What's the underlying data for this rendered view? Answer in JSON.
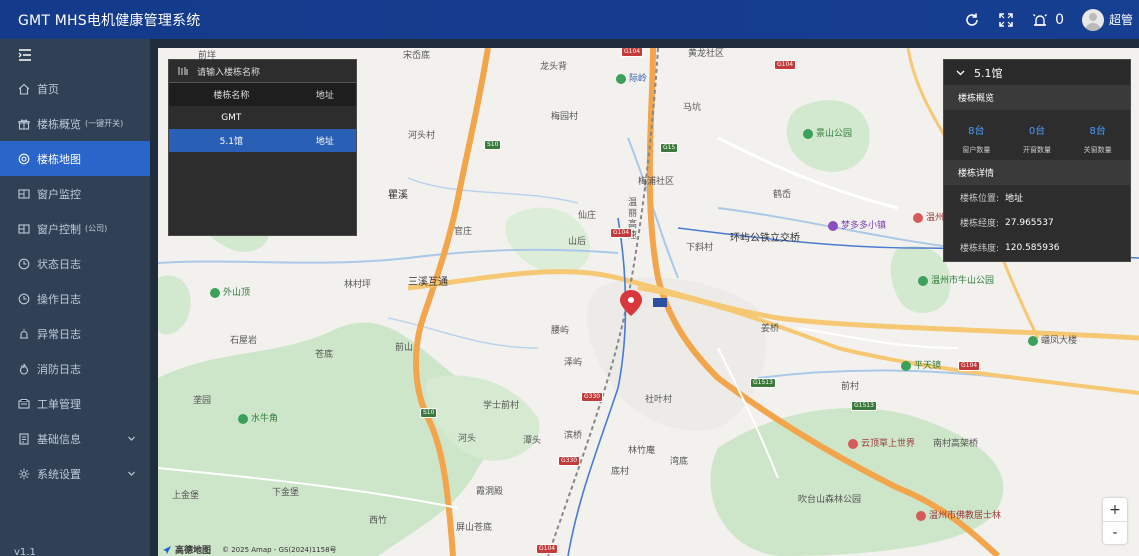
{
  "header": {
    "title": "GMT MHS电机健康管理系统",
    "alarm_count": "0",
    "username": "超管"
  },
  "sidebar": {
    "items": [
      {
        "label": "首页",
        "sub": "",
        "icon": "home-icon"
      },
      {
        "label": "楼栋概览",
        "sub": "(一键开关)",
        "icon": "gift-icon"
      },
      {
        "label": "楼栋地图",
        "sub": "",
        "icon": "target-icon"
      },
      {
        "label": "窗户监控",
        "sub": "",
        "icon": "window-icon"
      },
      {
        "label": "窗户控制",
        "sub": "(公司)",
        "icon": "window-icon"
      },
      {
        "label": "状态日志",
        "sub": "",
        "icon": "clock-icon"
      },
      {
        "label": "操作日志",
        "sub": "",
        "icon": "clock-icon"
      },
      {
        "label": "异常日志",
        "sub": "",
        "icon": "alarm-icon"
      },
      {
        "label": "消防日志",
        "sub": "",
        "icon": "fire-icon"
      },
      {
        "label": "工单管理",
        "sub": "",
        "icon": "ticket-icon"
      },
      {
        "label": "基础信息",
        "sub": "",
        "icon": "document-icon"
      },
      {
        "label": "系统设置",
        "sub": "",
        "icon": "gear-icon"
      }
    ],
    "active_index": 2,
    "version": "v1.1"
  },
  "building_list": {
    "search_placeholder": "请输入楼栋名称",
    "columns": [
      "楼栋名称",
      "地址"
    ],
    "rows": [
      {
        "name": "GMT",
        "address": ""
      },
      {
        "name": "5.1馆",
        "address": "地址"
      }
    ],
    "selected_index": 1
  },
  "building_detail": {
    "title": "5.1馆",
    "overview_label": "楼栋概览",
    "stats": [
      {
        "value": "8台",
        "label": "窗户数量"
      },
      {
        "value": "0台",
        "label": "开窗数量"
      },
      {
        "value": "8台",
        "label": "关窗数量"
      }
    ],
    "details_label": "楼栋详情",
    "position_label": "楼栋位置:",
    "position_value": "地址",
    "lng_label": "楼栋经度:",
    "lng_value": "27.965537",
    "lat_label": "楼栋纬度:",
    "lat_value": "120.585936"
  },
  "map": {
    "labels": [
      "前垟",
      "宋岙底",
      "黄龙社区",
      "龙头背",
      "际岭",
      "马坑",
      "梅园村",
      "景山公园",
      "河头村",
      "梅浦社区",
      "鹤岙",
      "温州",
      "瞿溪",
      "温丽高速",
      "仙庄",
      "山后",
      "环屿公铁立交桥",
      "梦多多小镇",
      "官庄",
      "下斜村",
      "三溪互通",
      "林村坪",
      "外山顶",
      "腰屿",
      "泽屿",
      "温州市牛山公园",
      "石屋岩",
      "苍底",
      "前山",
      "姜桥",
      "平天镜",
      "蟠凤大楼",
      "滨桥",
      "学士前村",
      "社叶村",
      "前村",
      "垄园",
      "水牛角",
      "南村高架桥",
      "云顶草上世界",
      "河头",
      "潭头",
      "林竹庵",
      "湾底",
      "底村",
      "上金堡",
      "下金堡",
      "霞洞殿",
      "西竹",
      "屏山苍底",
      "吹台山森林公园",
      "温州市佛教居士林"
    ],
    "roads": [
      "G104",
      "G15",
      "S10",
      "G1513",
      "G330"
    ],
    "zoom_in": "+",
    "zoom_out": "-",
    "logo": "高德地图",
    "copyright": "© 2025 Amap - GS(2024)1158号"
  },
  "colors": {
    "header_bg": "#153a8a",
    "sidebar_bg": "#304156",
    "active_menu": "#2a65c9",
    "panel_bg": "#2d2d2d",
    "stat_value": "#4c9bff",
    "marker": "#d9363e"
  }
}
